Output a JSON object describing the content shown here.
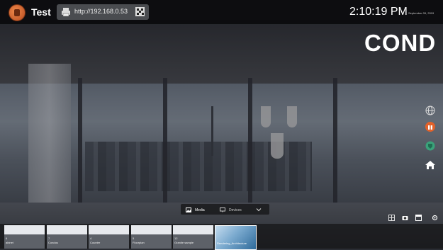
{
  "topbar": {
    "title": "Test",
    "url": "http://192.168.0.53",
    "time": "2:10:19 PM",
    "date": "September 09, 2019"
  },
  "brand": {
    "heading": "COND"
  },
  "media_controls": {
    "media_label": "Media",
    "devices_label": "Devices"
  },
  "thumbnails": [
    {
      "count": "6",
      "label": "abinet"
    },
    {
      "count": "7",
      "label": "Condos"
    },
    {
      "count": "4",
      "label": "Counter"
    },
    {
      "count": "5",
      "label": "Floorplan"
    },
    {
      "count": "12",
      "label": "Granite sample"
    },
    {
      "count": "",
      "label": "Rendering_Architecture"
    }
  ],
  "icons": {
    "app": "app-logo",
    "url_prefix": "printer-icon",
    "qr": "qr-code-icon",
    "side": [
      "globe-icon",
      "gift-icon",
      "tag-icon",
      "home-icon"
    ],
    "tools": [
      "grid-icon",
      "camera-icon",
      "window-icon",
      "settings-icon"
    ]
  },
  "colors": {
    "topbar": "#0a0a0c",
    "accent": "#ffffff"
  }
}
